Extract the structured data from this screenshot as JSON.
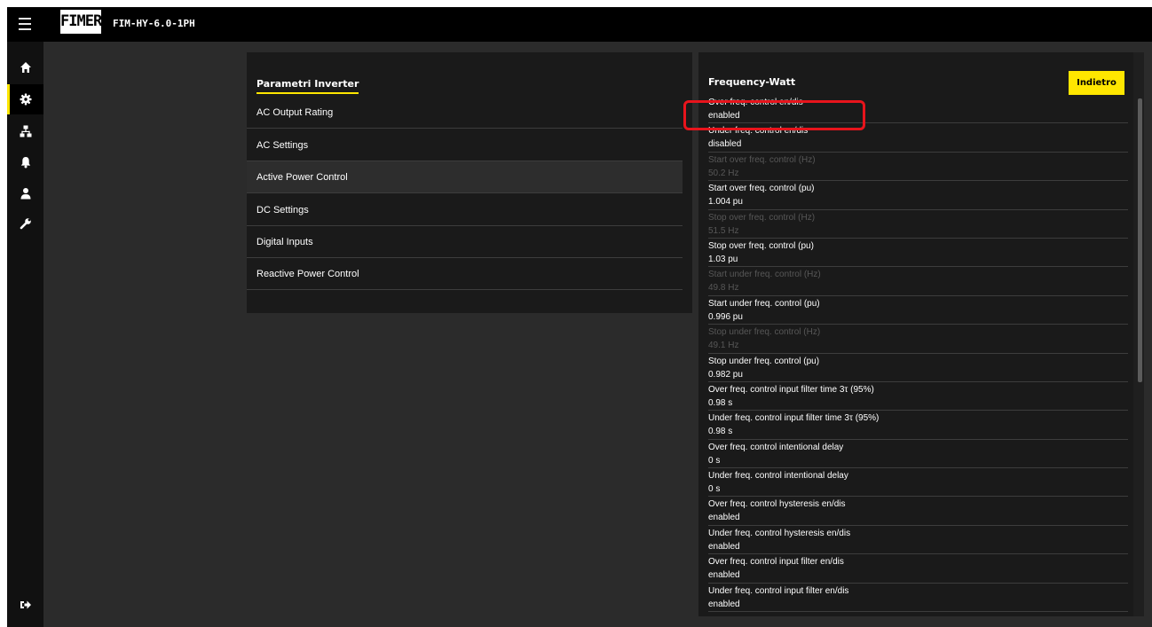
{
  "header": {
    "logo_text": "FIMER",
    "device_name": "FIM-HY-6.0-1PH"
  },
  "sidebar": {
    "items": [
      {
        "icon": "home-icon",
        "active": false
      },
      {
        "icon": "gear-icon",
        "active": true
      },
      {
        "icon": "network-icon",
        "active": false
      },
      {
        "icon": "bell-icon",
        "active": false
      },
      {
        "icon": "user-icon",
        "active": false
      },
      {
        "icon": "wrench-icon",
        "active": false
      }
    ],
    "logout_icon": "logout-icon"
  },
  "params_panel": {
    "title": "Parametri Inverter",
    "items": [
      {
        "label": "AC Output Rating",
        "selected": false
      },
      {
        "label": "AC Settings",
        "selected": false
      },
      {
        "label": "Active Power Control",
        "selected": true
      },
      {
        "label": "DC Settings",
        "selected": false
      },
      {
        "label": "Digital Inputs",
        "selected": false
      },
      {
        "label": "Reactive Power Control",
        "selected": false
      }
    ]
  },
  "fw_panel": {
    "title": "Frequency-Watt",
    "back_label": "Indietro",
    "rows": [
      {
        "label": "Over freq. control en/dis",
        "value": "enabled",
        "disabled": false
      },
      {
        "label": "Under freq. control en/dis",
        "value": "disabled",
        "disabled": false
      },
      {
        "label": "Start over freq. control (Hz)",
        "value": "50.2 Hz",
        "disabled": true
      },
      {
        "label": "Start over freq. control (pu)",
        "value": "1.004 pu",
        "disabled": false
      },
      {
        "label": "Stop over freq. control (Hz)",
        "value": "51.5 Hz",
        "disabled": true
      },
      {
        "label": "Stop over freq. control (pu)",
        "value": "1.03 pu",
        "disabled": false
      },
      {
        "label": "Start under freq. control (Hz)",
        "value": "49.8 Hz",
        "disabled": true
      },
      {
        "label": "Start under freq. control (pu)",
        "value": "0.996 pu",
        "disabled": false
      },
      {
        "label": "Stop under freq. control (Hz)",
        "value": "49.1 Hz",
        "disabled": true
      },
      {
        "label": "Stop under freq. control (pu)",
        "value": "0.982 pu",
        "disabled": false
      },
      {
        "label": "Over freq. control input filter time 3τ (95%)",
        "value": "0.98 s",
        "disabled": false
      },
      {
        "label": "Under freq. control input filter time 3τ (95%)",
        "value": "0.98 s",
        "disabled": false
      },
      {
        "label": "Over freq. control intentional delay",
        "value": "0 s",
        "disabled": false
      },
      {
        "label": "Under freq. control intentional delay",
        "value": "0 s",
        "disabled": false
      },
      {
        "label": "Over freq. control hysteresis en/dis",
        "value": "enabled",
        "disabled": false
      },
      {
        "label": "Under freq. control hysteresis en/dis",
        "value": "enabled",
        "disabled": false
      },
      {
        "label": "Over freq. control input filter en/dis",
        "value": "enabled",
        "disabled": false
      },
      {
        "label": "Under freq. control input filter en/dis",
        "value": "enabled",
        "disabled": false
      }
    ]
  },
  "colors": {
    "accent": "#ffe600",
    "highlight": "#e8141c",
    "background": "#2b2b2b",
    "panel": "#1a1a1a"
  }
}
